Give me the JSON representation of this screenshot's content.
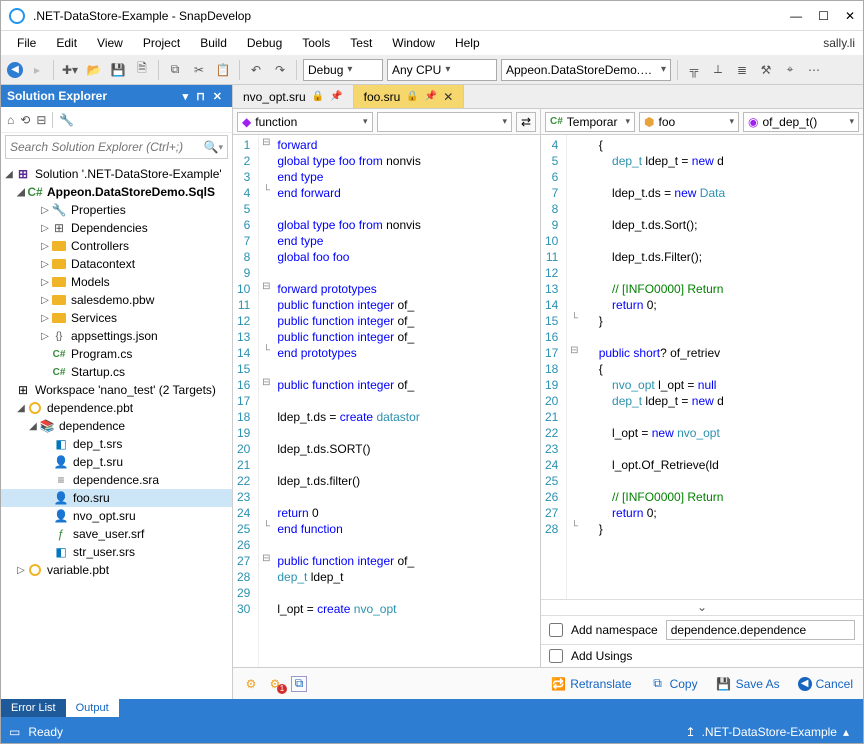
{
  "title": ".NET-DataStore-Example - SnapDevelop",
  "menubar": [
    "File",
    "Edit",
    "View",
    "Project",
    "Build",
    "Debug",
    "Tools",
    "Test",
    "Window",
    "Help"
  ],
  "user": "sally.li",
  "toolbar": {
    "config": "Debug",
    "platform": "Any CPU",
    "startup": "Appeon.DataStoreDemo.SqlS"
  },
  "solution_explorer": {
    "title": "Solution Explorer",
    "search_placeholder": "Search Solution Explorer (Ctrl+;)",
    "solution": "Solution '.NET-DataStore-Example'",
    "project": "Appeon.DataStoreDemo.SqlS",
    "items": {
      "properties": "Properties",
      "dependencies": "Dependencies",
      "controllers": "Controllers",
      "datacontext": "Datacontext",
      "models": "Models",
      "salesdemo": "salesdemo.pbw",
      "services": "Services",
      "appsettings": "appsettings.json",
      "program": "Program.cs",
      "startup": "Startup.cs"
    },
    "workspace": "Workspace 'nano_test' (2 Targets)",
    "pbt1": "dependence.pbt",
    "pbl": "dependence",
    "files": {
      "dep_srs": "dep_t.srs",
      "dep_sru": "dep_t.sru",
      "dependence_sra": "dependence.sra",
      "foo_sru": "foo.sru",
      "nvo_opt_sru": "nvo_opt.sru",
      "save_user_srf": "save_user.srf",
      "str_user_srs": "str_user.srs"
    },
    "pbt2": "variable.pbt"
  },
  "tabs": {
    "tab1": "nvo_opt.sru",
    "tab2": "foo.sru"
  },
  "nav_left": {
    "scope": "function"
  },
  "nav_right": {
    "d1": "Temporar",
    "d2": "foo",
    "d3": "of_dep_t()"
  },
  "left_code": {
    "lines": [
      1,
      2,
      3,
      4,
      5,
      6,
      7,
      8,
      9,
      10,
      11,
      12,
      13,
      14,
      15,
      16,
      17,
      18,
      19,
      20,
      21,
      22,
      23,
      24,
      25,
      26,
      27,
      28,
      29,
      30
    ],
    "text": [
      "forward",
      "global type foo from nonvis",
      "end type",
      "end forward",
      "",
      "global type foo from nonvis",
      "end type",
      "global foo foo",
      "",
      "forward prototypes",
      "public function integer of_",
      "public function integer of_",
      "public function integer of_",
      "end prototypes",
      "",
      "public function integer of_",
      "",
      "ldep_t.ds = create datastor",
      "",
      "ldep_t.ds.SORT()",
      "",
      "ldep_t.ds.filter()",
      "",
      "return 0",
      "end function",
      "",
      "public function integer of_",
      "dep_t ldep_t",
      "",
      "l_opt = create nvo_opt"
    ]
  },
  "right_code": {
    "lines": [
      4,
      5,
      6,
      7,
      8,
      9,
      10,
      11,
      12,
      13,
      14,
      15,
      16,
      17,
      18,
      19,
      20,
      21,
      22,
      23,
      24,
      25,
      26,
      27,
      28
    ],
    "text": [
      "{",
      "    dep_t ldep_t = new d",
      "",
      "    ldep_t.ds = new Data",
      "",
      "    ldep_t.ds.Sort();",
      "",
      "    ldep_t.ds.Filter();",
      "",
      "    // [INFO0000] Return",
      "    return 0;",
      "}",
      "",
      "public short? of_retriev",
      "{",
      "    nvo_opt l_opt = null",
      "    dep_t ldep_t = new d",
      "",
      "    l_opt = new nvo_opt",
      "",
      "    l_opt.Of_Retrieve(ld",
      "",
      "    // [INFO0000] Return",
      "    return 0;",
      "}"
    ]
  },
  "options": {
    "add_namespace_label": "Add namespace",
    "add_namespace_value": "dependence.dependence",
    "add_usings_label": "Add Usings"
  },
  "actions": {
    "retranslate": "Retranslate",
    "copy": "Copy",
    "save_as": "Save As",
    "cancel": "Cancel"
  },
  "bottom_tabs": {
    "error_list": "Error List",
    "output": "Output"
  },
  "status": {
    "ready": "Ready",
    "project": ".NET-DataStore-Example"
  }
}
